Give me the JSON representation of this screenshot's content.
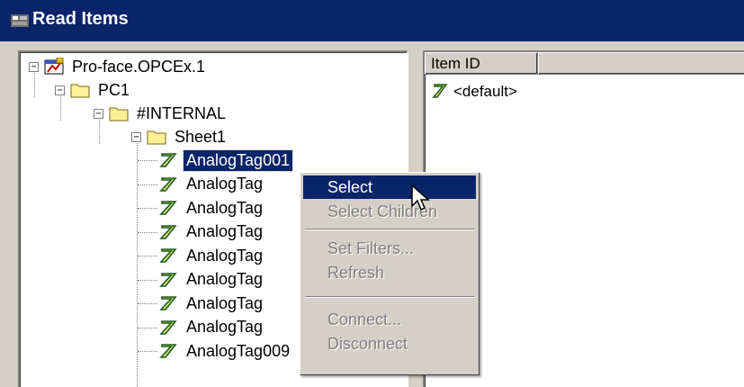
{
  "window": {
    "title": "Read Items"
  },
  "tree": {
    "root": "Pro-face.OPCEx.1",
    "pc": "PC1",
    "internal": "#INTERNAL",
    "sheet": "Sheet1",
    "tags": [
      "AnalogTag001",
      "AnalogTag",
      "AnalogTag",
      "AnalogTag",
      "AnalogTag",
      "AnalogTag",
      "AnalogTag",
      "AnalogTag",
      "AnalogTag009"
    ]
  },
  "list": {
    "columns": [
      "Item ID",
      ""
    ],
    "items": [
      "<default>"
    ]
  },
  "context_menu": {
    "items": [
      "Select",
      "Select Children",
      "Set Filters...",
      "Refresh",
      "Connect...",
      "Disconnect"
    ],
    "active": "Select"
  },
  "icons": {
    "tag": "tag-icon",
    "folder": "folder-icon",
    "server": "server-icon"
  },
  "colors": {
    "selection": "#0a246a",
    "titlebar": "#0a246a",
    "face": "#d4d0c8",
    "tag_green": "#1f7a1f"
  }
}
